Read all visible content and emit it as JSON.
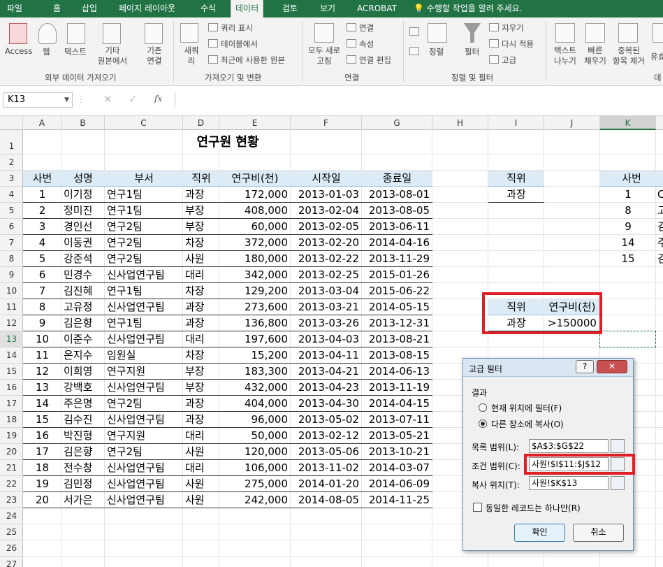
{
  "tabs": [
    {
      "label": "파일"
    },
    {
      "label": "홈"
    },
    {
      "label": "삽입"
    },
    {
      "label": "페이지 레이아웃"
    },
    {
      "label": "수식"
    },
    {
      "label": "데이터"
    },
    {
      "label": "검토"
    },
    {
      "label": "보기"
    },
    {
      "label": "ACROBAT"
    }
  ],
  "tellme": "수행할 작업을 알려 주세요.",
  "ribbon": {
    "ext": {
      "access": "Access",
      "web": "웹",
      "text": "텍스트",
      "other": "기타\n원본에서",
      "existing": "기존\n연결",
      "group": "외부 데이터 가져오기"
    },
    "gt": {
      "newq": "새쿼\n리",
      "show": "쿼리 표시",
      "table": "테이블에서",
      "recent": "최근에 사용한 원본",
      "group": "가져오기 및 변환"
    },
    "conn": {
      "refresh": "모두 새로\n고침",
      "connections": "연결",
      "props": "속성",
      "edit": "연결 편집",
      "group": "연결"
    },
    "sort": {
      "sort": "정렬",
      "filter": "필터",
      "clear": "지우기",
      "reapply": "다시 적용",
      "advanced": "고급",
      "group": "정렬 및 필터"
    },
    "tools": {
      "ttc": "텍스트\n나누기",
      "flash": "빠른\n채우기",
      "dup": "중복된\n항목 제거",
      "valid": "유효",
      "more": "데"
    }
  },
  "namebox": "K13",
  "fx": "fx",
  "columns": [
    "A",
    "B",
    "C",
    "D",
    "E",
    "F",
    "G",
    "H",
    "I",
    "J",
    "K"
  ],
  "rows": [
    "1",
    "2",
    "3",
    "4",
    "5",
    "6",
    "7",
    "8",
    "9",
    "10",
    "11",
    "12",
    "13",
    "14",
    "15",
    "16",
    "17",
    "18",
    "19",
    "20",
    "21",
    "22",
    "23",
    "24",
    "25",
    "26",
    "27"
  ],
  "sheet_title": "연구원 현황",
  "table_headers": [
    "사번",
    "성명",
    "부서",
    "직위",
    "연구비(천)",
    "시작일",
    "종료일"
  ],
  "table_rows": [
    [
      "1",
      "이기정",
      "연구1팀",
      "과장",
      "172,000",
      "2013-01-03",
      "2013-08-01"
    ],
    [
      "2",
      "정미진",
      "연구1팀",
      "부장",
      "408,000",
      "2013-02-04",
      "2013-08-05"
    ],
    [
      "3",
      "경인선",
      "연구2팀",
      "부장",
      "60,000",
      "2013-02-05",
      "2013-06-11"
    ],
    [
      "4",
      "이동권",
      "연구2팀",
      "차장",
      "372,000",
      "2013-02-20",
      "2014-04-16"
    ],
    [
      "5",
      "강준석",
      "연구2팀",
      "사원",
      "180,000",
      "2013-02-22",
      "2013-11-29"
    ],
    [
      "6",
      "민경수",
      "신사업연구팀",
      "대리",
      "342,000",
      "2013-02-25",
      "2015-01-26"
    ],
    [
      "7",
      "김진혜",
      "연구1팀",
      "차장",
      "129,200",
      "2013-03-04",
      "2015-06-22"
    ],
    [
      "8",
      "고유정",
      "신사업연구팀",
      "과장",
      "273,600",
      "2013-03-21",
      "2014-05-15"
    ],
    [
      "9",
      "김은향",
      "연구1팀",
      "과장",
      "136,800",
      "2013-03-26",
      "2013-12-31"
    ],
    [
      "10",
      "이준수",
      "신사업연구팀",
      "대리",
      "197,600",
      "2013-04-03",
      "2013-08-21"
    ],
    [
      "11",
      "온지수",
      "임원실",
      "차장",
      "15,200",
      "2013-04-11",
      "2013-08-15"
    ],
    [
      "12",
      "이희영",
      "연구지원",
      "부장",
      "183,300",
      "2013-04-21",
      "2014-06-13"
    ],
    [
      "13",
      "강백호",
      "신사업연구팀",
      "부장",
      "432,000",
      "2013-04-23",
      "2013-11-19"
    ],
    [
      "14",
      "주은명",
      "연구2팀",
      "과장",
      "404,000",
      "2013-04-30",
      "2014-04-15"
    ],
    [
      "15",
      "김수진",
      "신사업연구팀",
      "과장",
      "96,000",
      "2013-05-02",
      "2013-07-11"
    ],
    [
      "16",
      "박진형",
      "연구지원",
      "대리",
      "50,000",
      "2013-02-12",
      "2013-05-21"
    ],
    [
      "17",
      "김은향",
      "연구2팀",
      "사원",
      "120,000",
      "2013-05-06",
      "2013-10-21"
    ],
    [
      "18",
      "전수창",
      "신사업연구팀",
      "대리",
      "106,000",
      "2013-11-02",
      "2014-03-07"
    ],
    [
      "19",
      "김민정",
      "신사업연구팀",
      "사원",
      "275,000",
      "2014-01-20",
      "2014-06-09"
    ],
    [
      "20",
      "서가은",
      "신사업연구팀",
      "사원",
      "242,000",
      "2014-08-05",
      "2014-11-25"
    ]
  ],
  "crit1": {
    "header": "직위",
    "value": "과장"
  },
  "crit2": {
    "headers": [
      "직위",
      "연구비(천)"
    ],
    "values": [
      "과장",
      ">150000"
    ]
  },
  "kcol": {
    "header": "사번",
    "values": [
      "1",
      "8",
      "9",
      "14",
      "15"
    ],
    "partial": [
      "C",
      "고",
      "김",
      "주",
      "김"
    ]
  },
  "dialog": {
    "title": "고급 필터",
    "help": "?",
    "close": "✕",
    "result_label": "결과",
    "opt1": "현재 위치에 필터(F)",
    "opt2": "다른 장소에 복사(O)",
    "list_label": "목록 범위(L):",
    "list_value": "$A$3:$G$22",
    "crit_label": "조건 범위(C):",
    "crit_value": "사원!$I$11:$J$12",
    "copy_label": "복사 위치(T):",
    "copy_value": "사원!$K$13",
    "unique_label": "동일한 레코드는 하나만(R)",
    "ok": "확인",
    "cancel": "취소"
  }
}
